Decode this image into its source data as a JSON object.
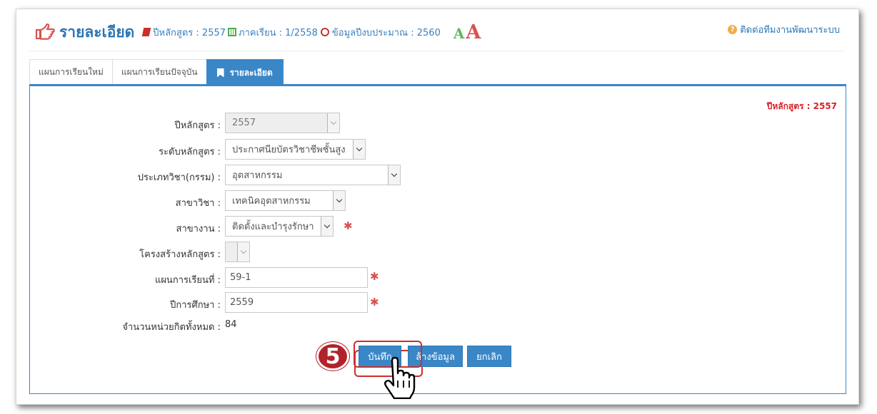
{
  "header": {
    "title": "รายละเอียด",
    "curriculum_year_text": "ปีหลักสูตร : 2557",
    "semester_text": "ภาคเรียน : 1/2558",
    "budget_year_text": "ข้อมูลปีงบประมาณ : 2560",
    "font_small": "A",
    "font_large": "A",
    "help_link": "ติดต่อทีมงานพัฒนาระบบ"
  },
  "tabs": [
    {
      "label": "แผนการเรียนใหม่"
    },
    {
      "label": "แผนการเรียนปัจจุบัน"
    },
    {
      "label": "รายละเอียด"
    }
  ],
  "panel": {
    "year_badge": "ปีหลักสูตร : 2557"
  },
  "form": {
    "curriculum_year": {
      "label": "ปีหลักสูตร :",
      "value": "2557"
    },
    "curriculum_level": {
      "label": "ระดับหลักสูตร :",
      "value": "ประกาศนียบัตรวิชาชีพชั้นสูง"
    },
    "subject_type": {
      "label": "ประเภทวิชา(กรรม) :",
      "value": "อุตสาหกรรม"
    },
    "major": {
      "label": "สาขาวิชา :",
      "value": "เทคนิคอุตสาหกรรม"
    },
    "branch": {
      "label": "สาขางาน :",
      "value": "ติดตั้งและบำรุงรักษา"
    },
    "structure": {
      "label": "โครงสร้างหลักสูตร :",
      "value": ""
    },
    "study_plan": {
      "label": "แผนการเรียนที่ :",
      "value": "59-1"
    },
    "academic_year": {
      "label": "ปีการศึกษา :",
      "value": "2559"
    },
    "total_credits": {
      "label": "จำนวนหน่วยกิตทั้งหมด :",
      "value": "84"
    },
    "required_mark": "✱"
  },
  "buttons": {
    "save": "บันทึก",
    "clear": "ล้างข้อมูล",
    "cancel": "ยกเลิก"
  },
  "annotation": {
    "step_number": "5"
  },
  "colors": {
    "primary": "#3a87c8",
    "required": "#d9534f",
    "badge": "#b3222a",
    "year_badge": "#d9232b"
  }
}
